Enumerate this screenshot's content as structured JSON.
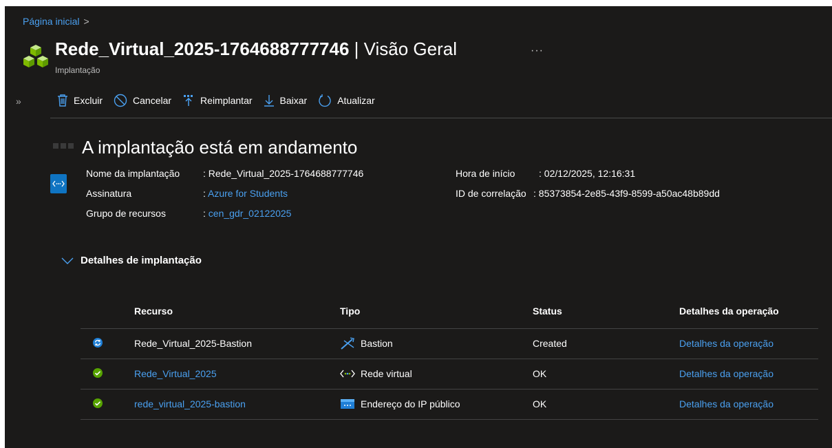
{
  "breadcrumb": {
    "home": "Página inicial",
    "separator": ">"
  },
  "header": {
    "name": "Rede_Virtual_2025-1764688777746",
    "separator": " | ",
    "view": "Visão Geral",
    "more": "···",
    "type_label": "Implantação",
    "icon": "deployment-cubes-icon"
  },
  "toolbar": {
    "expand": "»",
    "items": [
      {
        "label": "Excluir",
        "icon": "trash-icon"
      },
      {
        "label": "Cancelar",
        "icon": "cancel-icon"
      },
      {
        "label": "Reimplantar",
        "icon": "redeploy-icon"
      },
      {
        "label": "Baixar",
        "icon": "download-icon"
      },
      {
        "label": "Atualizar",
        "icon": "refresh-icon"
      }
    ]
  },
  "status": {
    "title": "A implantação está em andamento"
  },
  "info": {
    "deployment_name_label": "Nome da implantação",
    "deployment_name": ": Rede_Virtual_2025-1764688777746",
    "subscription_label": "Assinatura",
    "subscription_prefix": ": ",
    "subscription": "Azure for Students",
    "resource_group_label": "Grupo de recursos",
    "resource_group_prefix": ": ",
    "resource_group": "cen_gdr_02122025",
    "start_time_label": "Hora de início",
    "start_time": ": 02/12/2025, 12:16:31",
    "correlation_label": "ID de correlação",
    "correlation_id": ": 85373854-2e85-43f9-8599-a50ac48b89dd"
  },
  "details": {
    "section_title": "Detalhes de implantação",
    "columns": [
      "Recurso",
      "Tipo",
      "Status",
      "Detalhes da operação"
    ],
    "rows": [
      {
        "status_icon": "in-progress-sync-icon",
        "resource": "Rede_Virtual_2025-Bastion",
        "resource_is_link": false,
        "type_icon": "bastion-icon",
        "type": "Bastion",
        "status": "Created",
        "op_details": "Detalhes da operação"
      },
      {
        "status_icon": "success-check-icon",
        "resource": "Rede_Virtual_2025",
        "resource_is_link": true,
        "type_icon": "virtual-network-icon",
        "type": "Rede virtual",
        "status": "OK",
        "op_details": "Detalhes da operação"
      },
      {
        "status_icon": "success-check-icon",
        "resource": "rede_virtual_2025-bastion",
        "resource_is_link": true,
        "type_icon": "public-ip-icon",
        "type": "Endereço do IP público",
        "status": "OK",
        "op_details": "Detalhes da operação"
      }
    ]
  },
  "colors": {
    "background": "#1b1a19",
    "link": "#4aa0f0",
    "success": "#57a300",
    "info": "#0f74c2"
  }
}
